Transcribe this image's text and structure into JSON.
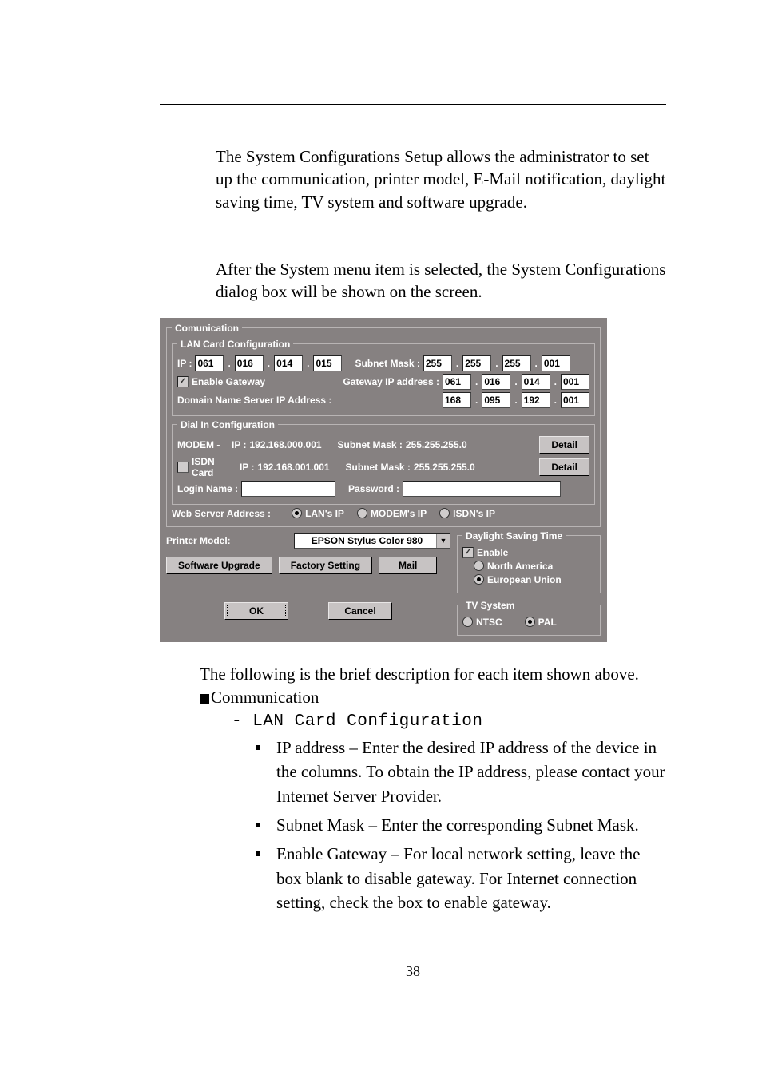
{
  "intro": {
    "p1": "The System Configurations Setup allows the administrator to set up the communication, printer model, E-Mail notification, daylight saving time, TV system and software upgrade.",
    "p2": "After the System menu item is selected, the System Configurations dialog box will be shown on the screen."
  },
  "dialog": {
    "comm_legend": "Comunication",
    "lan": {
      "legend": "LAN Card Configuration",
      "ip_label": "IP :",
      "ip": [
        "061",
        "016",
        "014",
        "015"
      ],
      "subnet_label": "Subnet Mask :",
      "subnet": [
        "255",
        "255",
        "255",
        "001"
      ],
      "enable_gateway_label": "Enable Gateway",
      "enable_gateway_checked": true,
      "gateway_label": "Gateway IP address :",
      "gateway": [
        "061",
        "016",
        "014",
        "001"
      ],
      "dns_label": "Domain Name Server IP  Address :",
      "dns": [
        "168",
        "095",
        "192",
        "001"
      ]
    },
    "dial": {
      "legend": "Dial In Configuration",
      "modem_label": "MODEM  -",
      "ip_label": "IP :",
      "modem_ip": "192.168.000.001",
      "subnet_label": "Subnet Mask :",
      "modem_subnet": "255.255.255.0",
      "detail_btn": "Detail",
      "isdn_label": "ISDN Card",
      "isdn_checked": false,
      "isdn_ip": "192.168.001.001",
      "isdn_subnet": "255.255.255.0",
      "login_label": "Login Name :",
      "pass_label": "Password :"
    },
    "web": {
      "label": "Web Server Address :",
      "opt_lan": "LAN's IP",
      "opt_modem": "MODEM's IP",
      "opt_isdn": "ISDN's IP",
      "selected": "lan"
    },
    "printer": {
      "label": "Printer Model:",
      "value": "EPSON Stylus Color 980"
    },
    "dst": {
      "legend": "Daylight Saving Time",
      "enable_label": "Enable",
      "enable_checked": true,
      "na_label": "North America",
      "eu_label": "European Union",
      "selected": "eu"
    },
    "btns": {
      "upgrade": "Software Upgrade",
      "factory": "Factory Setting",
      "mail": "Mail",
      "ok": "OK",
      "cancel": "Cancel"
    },
    "tv": {
      "legend": "TV System",
      "ntsc": "NTSC",
      "pal": "PAL",
      "selected": "pal"
    }
  },
  "post": {
    "intro": "The following is the brief description for each item shown above.",
    "sec_comm": "Communication",
    "lan_title_prefix": "- ",
    "lan_title": "LAN Card Configuration",
    "items": {
      "ip": "IP address – Enter the desired IP address of the device in the columns. To obtain the IP address, please contact your Internet Server Provider.",
      "subnet": "Subnet Mask – Enter the corresponding Subnet Mask.",
      "gateway": "Enable Gateway – For local network setting, leave the box blank to disable gateway. For Internet connection setting, check the box to enable gateway."
    }
  },
  "page_number": "38"
}
